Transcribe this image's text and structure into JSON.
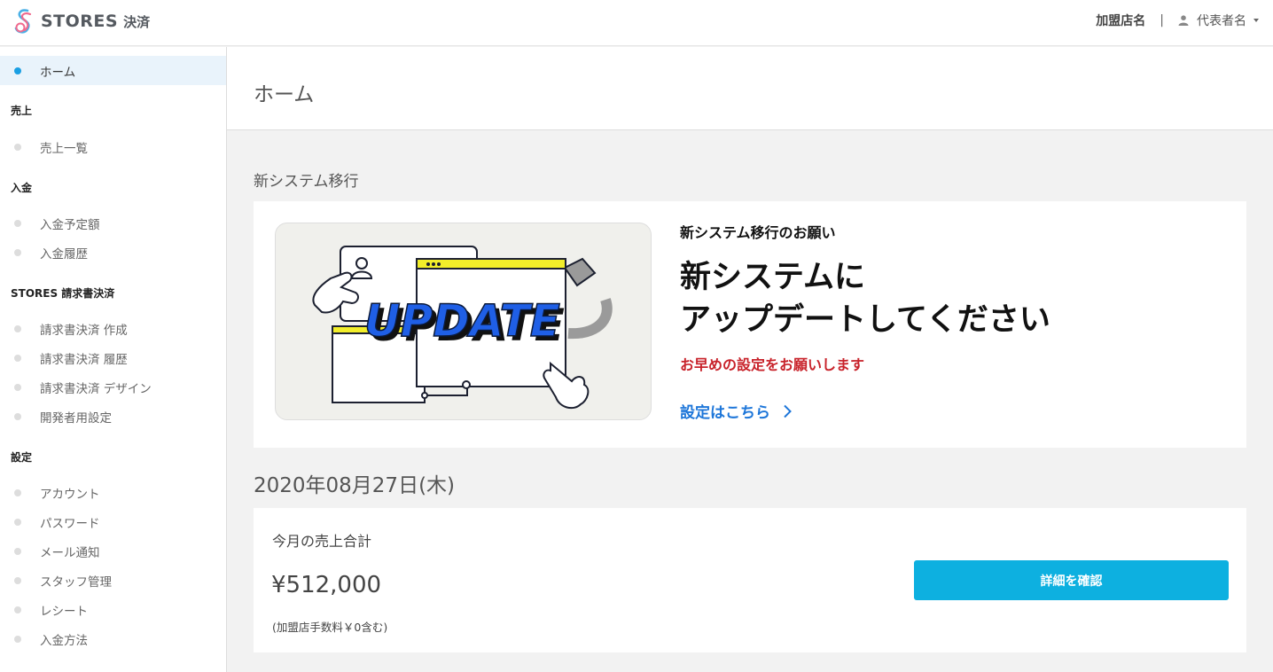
{
  "header": {
    "logo_text": "STORES",
    "logo_sub": "決済",
    "store_name": "加盟店名",
    "separator": "|",
    "representative_name": "代表者名",
    "brand_colors": {
      "pink": "#f06b8f",
      "blue": "#4ab0e6"
    }
  },
  "sidebar": {
    "home": "ホーム",
    "sections": [
      {
        "title": "売上",
        "items": [
          "売上一覧"
        ]
      },
      {
        "title": "入金",
        "items": [
          "入金予定額",
          "入金履歴"
        ]
      },
      {
        "title": "STORES 請求書決済",
        "items": [
          "請求書決済 作成",
          "請求書決済 履歴",
          "請求書決済 デザイン",
          "開発者用設定"
        ]
      },
      {
        "title": "設定",
        "items": [
          "アカウント",
          "パスワード",
          "メール通知",
          "スタッフ管理",
          "レシート",
          "入金方法"
        ]
      }
    ],
    "active_color": "#1a9fe3"
  },
  "page": {
    "title": "ホーム",
    "migration_label": "新システム移行"
  },
  "banner": {
    "illustration_text": "UPDATE",
    "subtitle": "新システム移行のお願い",
    "title_line1": "新システムに",
    "title_line2": "アップデートしてください",
    "warning": "お早めの設定をお願いします",
    "link": "設定はこちら",
    "warning_color": "#c8222a",
    "link_color": "#1d76d9"
  },
  "date_label": "2020年08月27日(木)",
  "sales": {
    "title": "今月の売上合計",
    "amount": "¥512,000",
    "note": "(加盟店手数料￥0含む)",
    "button": "詳細を確認",
    "button_color": "#0db0e0"
  }
}
